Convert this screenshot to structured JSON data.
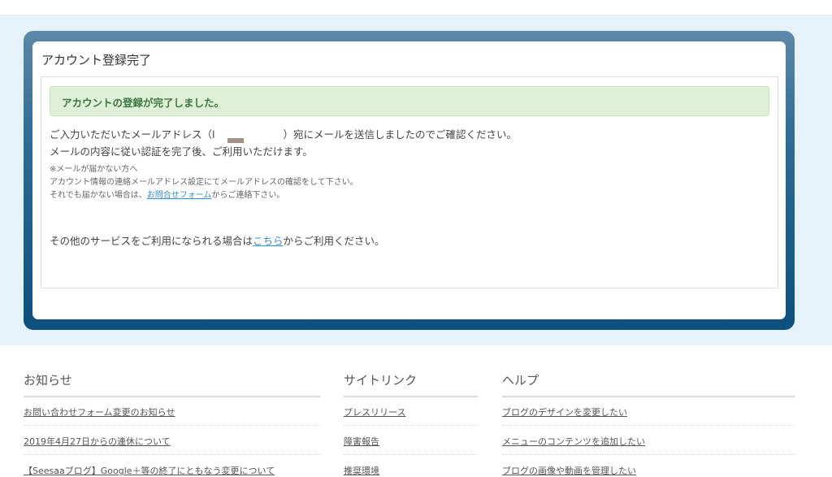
{
  "panel": {
    "title": "アカウント登録完了",
    "success_message": "アカウントの登録が完了しました。",
    "line1_pre": "ご入力いただいたメールアドレス（l",
    "line1_post": "）宛にメールを送信しましたのでご確認ください。",
    "line2": "メールの内容に従い認証を完了後、ご利用いただけます。",
    "note1": "※メールが届かない方へ",
    "note2": "アカウント情報の連絡メールアドレス設定にてメールアドレスの確認をして下さい。",
    "note3_pre": "それでも届かない場合は、",
    "note3_link": "お問合せフォーム",
    "note3_post": "からご連絡下さい。",
    "other_pre": "その他のサービスをご利用になられる場合は",
    "other_link": "こちら",
    "other_post": "からご利用ください。"
  },
  "footer": {
    "news": {
      "heading": "お知らせ",
      "items": [
        "お問い合わせフォーム変更のお知らせ",
        "2019年4月27日からの連休について",
        "【Seesaaブログ】Google＋等の終了にともなう変更について"
      ]
    },
    "sitelinks": {
      "heading": "サイトリンク",
      "items": [
        "プレスリリース",
        "障害報告",
        "推奨環境"
      ]
    },
    "help": {
      "heading": "ヘルプ",
      "items": [
        "ブログのデザインを変更したい",
        "メニューのコンテンツを追加したい",
        "ブログの画像や動画を管理したい"
      ]
    }
  }
}
